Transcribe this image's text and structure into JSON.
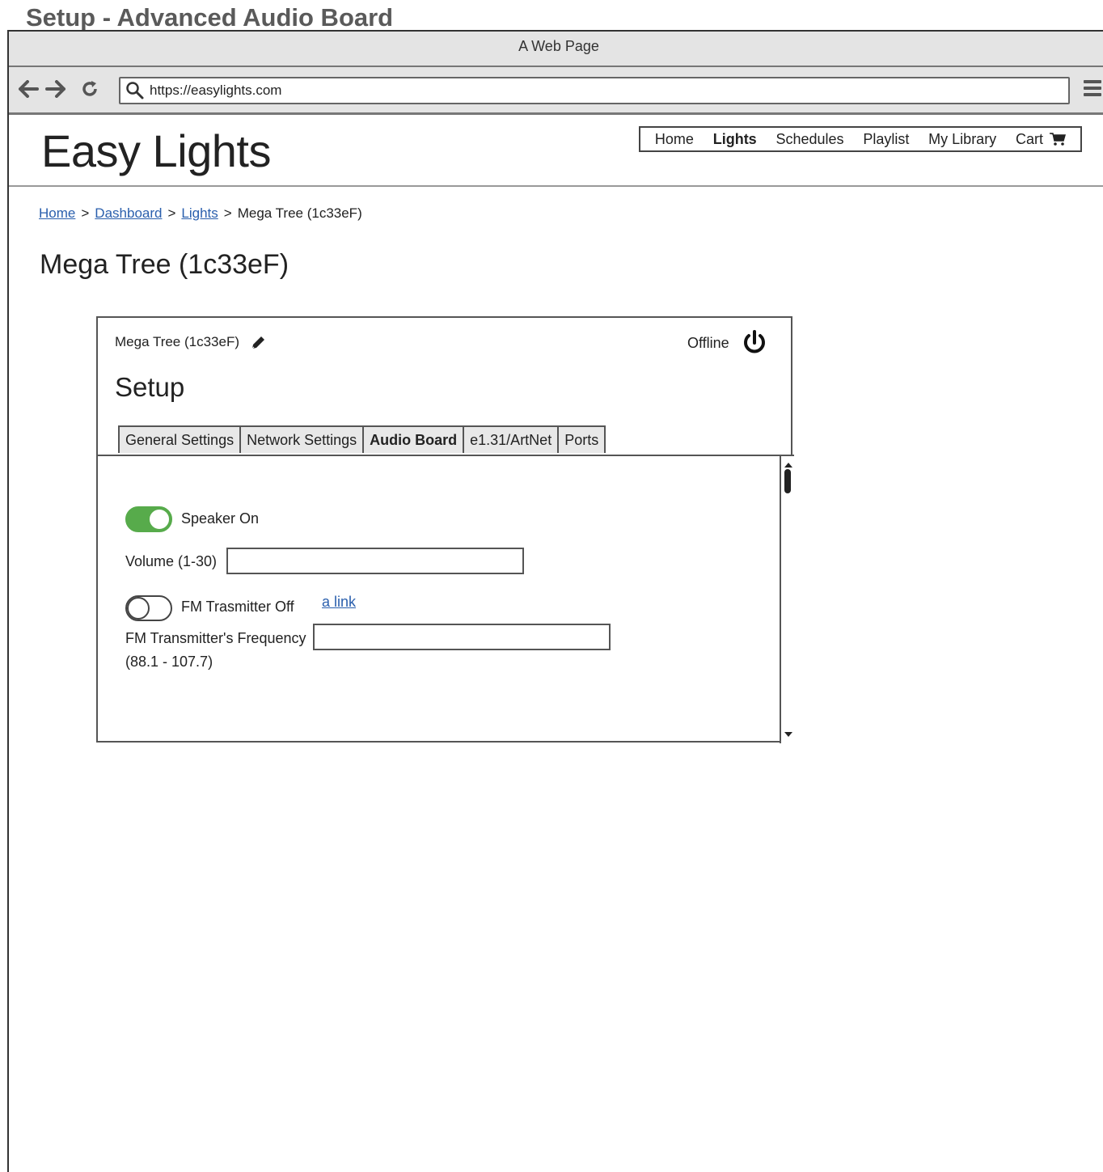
{
  "screen_title": "Setup - Advanced Audio Board",
  "browser": {
    "window_title": "A Web Page",
    "url": "https://easylights.com"
  },
  "site": {
    "logo": "Easy Lights",
    "nav": [
      {
        "label": "Home",
        "active": false
      },
      {
        "label": "Lights",
        "active": true
      },
      {
        "label": "Schedules",
        "active": false
      },
      {
        "label": "Playlist",
        "active": false
      },
      {
        "label": "My Library",
        "active": false
      },
      {
        "label": "Cart",
        "active": false
      }
    ]
  },
  "breadcrumb": {
    "home": "Home",
    "dashboard": "Dashboard",
    "lights": "Lights",
    "current": "Mega Tree (1c33eF)",
    "sep": ">"
  },
  "page": {
    "heading": "Mega Tree (1c33eF)"
  },
  "panel": {
    "device_name": "Mega Tree (1c33eF)",
    "status": "Offline",
    "title": "Setup",
    "tabs": [
      {
        "label": "General Settings",
        "active": false
      },
      {
        "label": "Network Settings",
        "active": false
      },
      {
        "label": "Audio Board",
        "active": true
      },
      {
        "label": "e1.31/ArtNet",
        "active": false
      },
      {
        "label": "Ports",
        "active": false
      }
    ],
    "audio": {
      "speaker_label": "Speaker On",
      "speaker_on": true,
      "volume_label": "Volume (1-30)",
      "volume_value": "",
      "fm_label": "FM Trasmitter Off",
      "fm_on": false,
      "link_text": "a link",
      "frequency_label": "FM Transmitter's Frequency",
      "frequency_range": "(88.1 - 107.7)",
      "frequency_value": ""
    }
  },
  "colors": {
    "toggle_on": "#57ab4b",
    "link": "#2a5fad",
    "chrome_bg": "#e4e4e4"
  }
}
